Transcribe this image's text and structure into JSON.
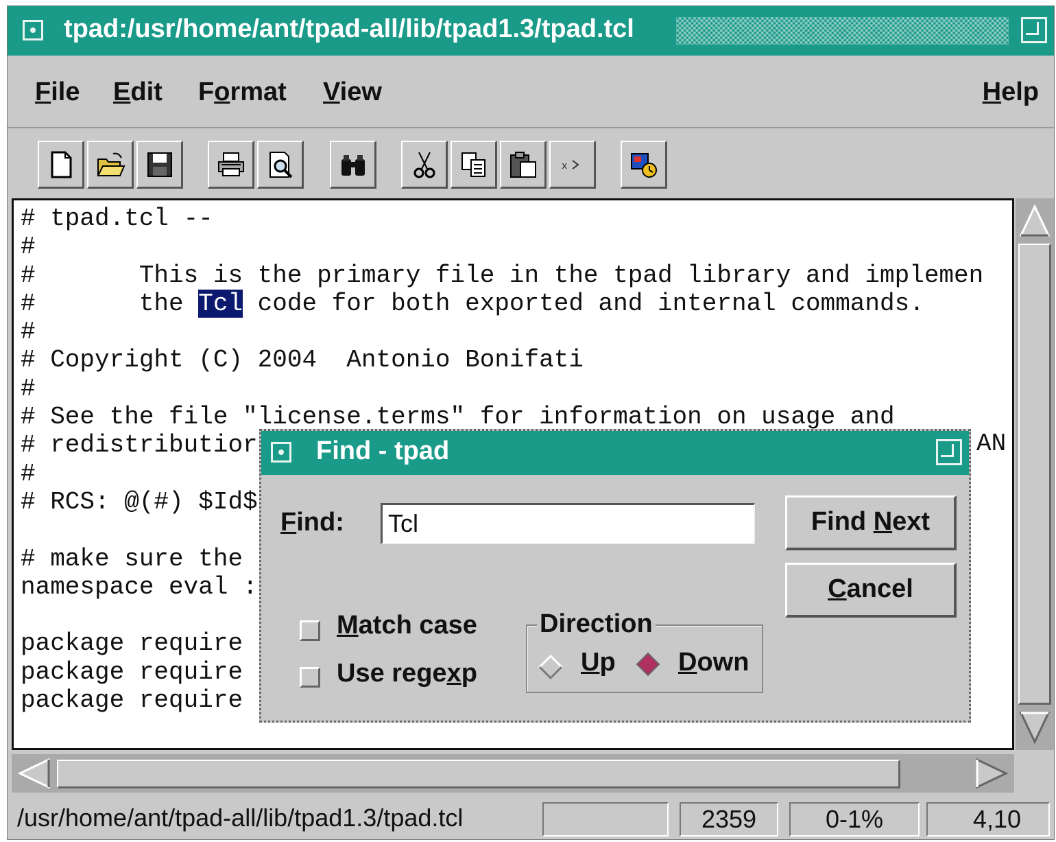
{
  "window": {
    "title": "tpad:/usr/home/ant/tpad-all/lib/tpad1.3/tpad.tcl"
  },
  "menubar": {
    "file": {
      "label": "File",
      "mnemonic": "F",
      "rest": "ile"
    },
    "edit": {
      "label": "Edit",
      "mnemonic": "E",
      "rest": "dit"
    },
    "format": {
      "label": "Format",
      "pre": "F",
      "mnemonic": "o",
      "rest": "rmat"
    },
    "view": {
      "label": "View",
      "mnemonic": "V",
      "rest": "iew"
    },
    "help": {
      "label": "Help",
      "mnemonic": "H",
      "rest": "elp"
    }
  },
  "toolbar": {
    "icons": [
      "new-file-icon",
      "open-folder-icon",
      "save-icon",
      "print-icon",
      "print-preview-icon",
      "find-binoculars-icon",
      "cut-icon",
      "copy-icon",
      "paste-icon",
      "clear-icon",
      "properties-icon"
    ]
  },
  "editor": {
    "lines": [
      "# tpad.tcl --",
      "#",
      "#       This is the primary file in the tpad library and implemen",
      "#       the ",
      "#",
      "# Copyright (C) 2004  Antonio Bonifati",
      "#",
      "# See the file \"license.terms\" for information on usage and",
      "# redistributior",
      "#",
      "# RCS: @(#) $Id$",
      "",
      "# make sure the ",
      "namespace eval :",
      "",
      "package require ",
      "package require ",
      "package require "
    ],
    "line4_selected": "Tcl",
    "line4_after": " code for both exported and internal commands.",
    "line9_tail": "AN"
  },
  "statusbar": {
    "path": "/usr/home/ant/tpad-all/lib/tpad1.3/tpad.tcl",
    "empty": "",
    "size": "2359",
    "percent": "0-1%",
    "position": "4,10"
  },
  "find_dialog": {
    "title": "Find - tpad",
    "find_label": "Find:",
    "find_value": "Tcl",
    "find_next": "Find Next",
    "cancel": "Cancel",
    "match_case": "Match case",
    "use_regexp": "Use regexp",
    "direction": "Direction",
    "up": "Up",
    "down": "Down",
    "selected_direction": "Down"
  },
  "colors": {
    "titlebar": "#1a9a88",
    "selection": "#0b1a6e",
    "radio_selected": "#b03060"
  }
}
